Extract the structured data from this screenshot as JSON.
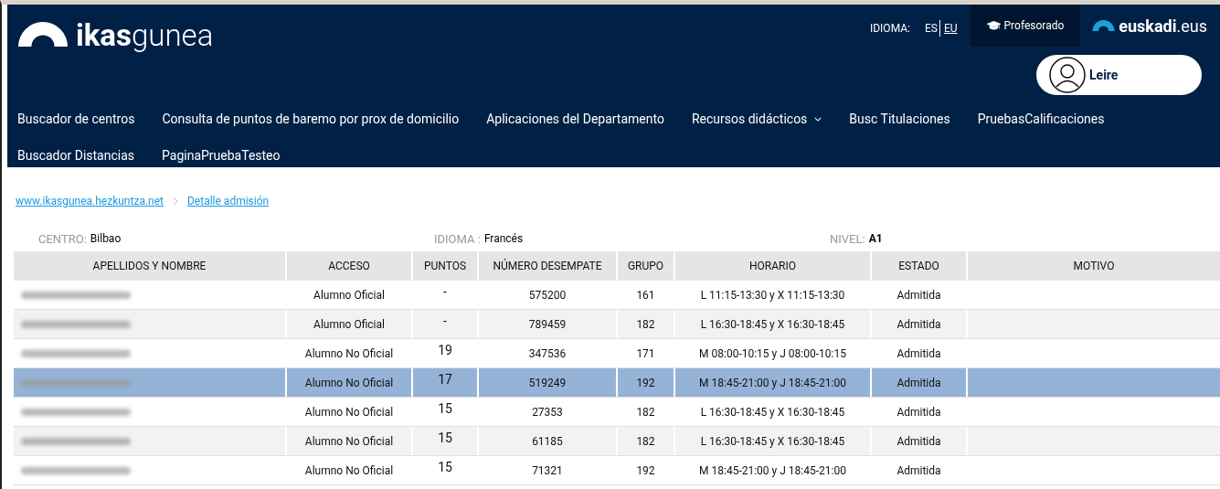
{
  "header": {
    "logo_bold": "ikas",
    "logo_light": "gunea",
    "language_label": "IDIOMA:",
    "languages": [
      {
        "label": "ES",
        "selected": false
      },
      {
        "label": "EU",
        "selected": true
      }
    ],
    "profile_link": "Profesorado",
    "site_bold": "euskadi",
    "site_light": ".eus",
    "user": "Leire"
  },
  "nav": [
    {
      "label": "Buscador de centros",
      "dropdown": false
    },
    {
      "label": "Consulta de puntos de baremo por prox de domicilio",
      "dropdown": false
    },
    {
      "label": "Aplicaciones del Departamento",
      "dropdown": false
    },
    {
      "label": "Recursos didácticos",
      "dropdown": true
    },
    {
      "label": "Busc Titulaciones",
      "dropdown": false
    },
    {
      "label": "PruebasCalificaciones",
      "dropdown": false
    },
    {
      "label": "Buscador Distancias",
      "dropdown": false
    },
    {
      "label": "PaginaPruebaTesteo",
      "dropdown": false
    }
  ],
  "breadcrumb": [
    "www.ikasgunea.hezkuntza.net",
    "Detalle admisión"
  ],
  "filters": [
    {
      "label": "CENTRO:",
      "value": "Bilbao"
    },
    {
      "label": "IDIOMA :",
      "value": "Francés"
    },
    {
      "label": "NIVEL:",
      "value": "A1"
    }
  ],
  "table": {
    "columns": [
      "APELLIDOS Y NOMBRE",
      "ACCESO",
      "PUNTOS",
      "NÚMERO DESEMPATE",
      "GRUPO",
      "HORARIO",
      "ESTADO",
      "MOTIVO"
    ],
    "rows": [
      {
        "selected": false,
        "cells": [
          "",
          "Alumno Oficial",
          "-",
          "575200",
          "161",
          "L 11:15-13:30 y X 11:15-13:30",
          "Admitida"
        ]
      },
      {
        "selected": false,
        "cells": [
          "",
          "Alumno Oficial",
          "-",
          "789459",
          "182",
          "L 16:30-18:45 y X 16:30-18:45",
          "Admitida"
        ]
      },
      {
        "selected": false,
        "cells": [
          "",
          "Alumno No Oficial",
          "19",
          "347536",
          "171",
          "M 08:00-10:15 y J 08:00-10:15",
          "Admitida"
        ]
      },
      {
        "selected": true,
        "cells": [
          "",
          "Alumno No Oficial",
          "17",
          "519249",
          "192",
          "M 18:45-21:00 y J 18:45-21:00",
          "Admitida"
        ]
      },
      {
        "selected": false,
        "cells": [
          "",
          "Alumno No Oficial",
          "15",
          "27353",
          "182",
          "L 16:30-18:45 y X 16:30-18:45",
          "Admitida"
        ]
      },
      {
        "selected": false,
        "cells": [
          "",
          "Alumno No Oficial",
          "15",
          "61185",
          "182",
          "L 16:30-18:45 y X 16:30-18:45",
          "Admitida"
        ]
      },
      {
        "selected": false,
        "cells": [
          "",
          "Alumno No Oficial",
          "15",
          "71321",
          "192",
          "M 18:45-21:00 y J 18:45-21:00",
          "Admitida"
        ]
      }
    ]
  }
}
